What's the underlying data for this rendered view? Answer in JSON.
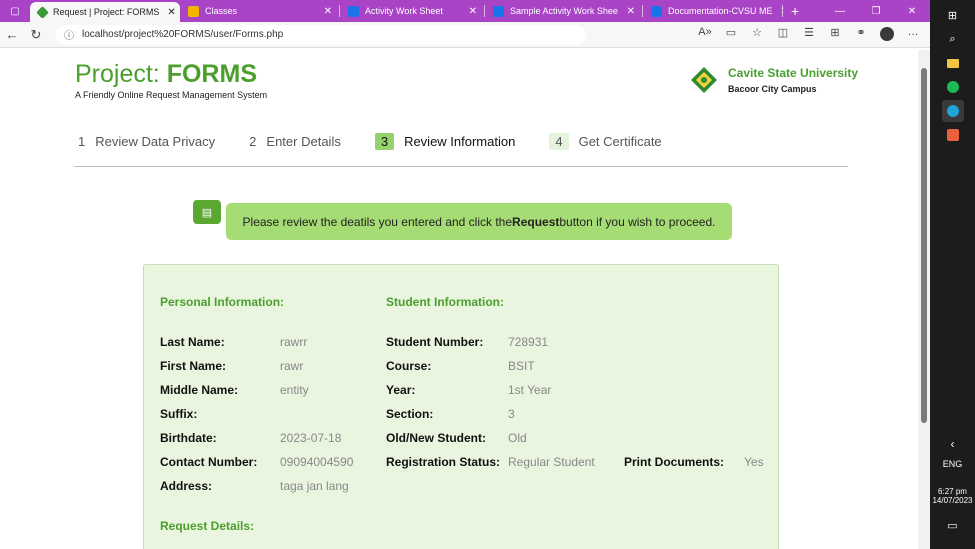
{
  "browser": {
    "tabs": [
      {
        "title": "Request | Project: FORMS",
        "fav_color": "#3a9a3a"
      },
      {
        "title": "Classes",
        "fav_color": "#f4b400"
      },
      {
        "title": "Activity Work Sheet",
        "fav_color": "#1a73e8"
      },
      {
        "title": "Sample Activity Work Shee",
        "fav_color": "#1a73e8"
      },
      {
        "title": "Documentation-CVSU ME",
        "fav_color": "#1a73e8"
      }
    ],
    "url": "localhost/project%20FORMS/user/Forms.php"
  },
  "taskbar": {
    "lang": "ENG",
    "time": "6:27 pm",
    "date": "14/07/2023"
  },
  "header": {
    "title_light": "Project:",
    "title_bold": "FORMS",
    "subtitle": "A Friendly Online Request Management System",
    "university": "Cavite State University",
    "campus": "Bacoor City Campus"
  },
  "steps": [
    {
      "num": "1",
      "label": "Review Data Privacy"
    },
    {
      "num": "2",
      "label": "Enter Details"
    },
    {
      "num": "3",
      "label": "Review Information"
    },
    {
      "num": "4",
      "label": "Get Certificate"
    }
  ],
  "notice": {
    "before": "Please review the deatils you entered and click the ",
    "bold": "Request",
    "after": " button if you wish to proceed."
  },
  "personal": {
    "heading": "Personal Information:",
    "last_name_label": "Last Name:",
    "last_name": "rawrr",
    "first_name_label": "First Name:",
    "first_name": "rawr",
    "middle_name_label": "Middle Name:",
    "middle_name": "entity",
    "suffix_label": "Suffix:",
    "suffix": "",
    "birthdate_label": "Birthdate:",
    "birthdate": "2023-07-18",
    "contact_label": "Contact Number:",
    "contact": "09094004590",
    "address_label": "Address:",
    "address": "taga jan lang"
  },
  "student": {
    "heading": "Student Information:",
    "number_label": "Student Number:",
    "number": "728931",
    "course_label": "Course:",
    "course": "BSIT",
    "year_label": "Year:",
    "year": "1st Year",
    "section_label": "Section:",
    "section": "3",
    "oldnew_label": "Old/New Student:",
    "oldnew": "Old",
    "reg_label": "Registration Status:",
    "reg": "Regular Student",
    "print_label": "Print Documents:",
    "print": "Yes"
  },
  "request": {
    "heading": "Request Details:"
  }
}
